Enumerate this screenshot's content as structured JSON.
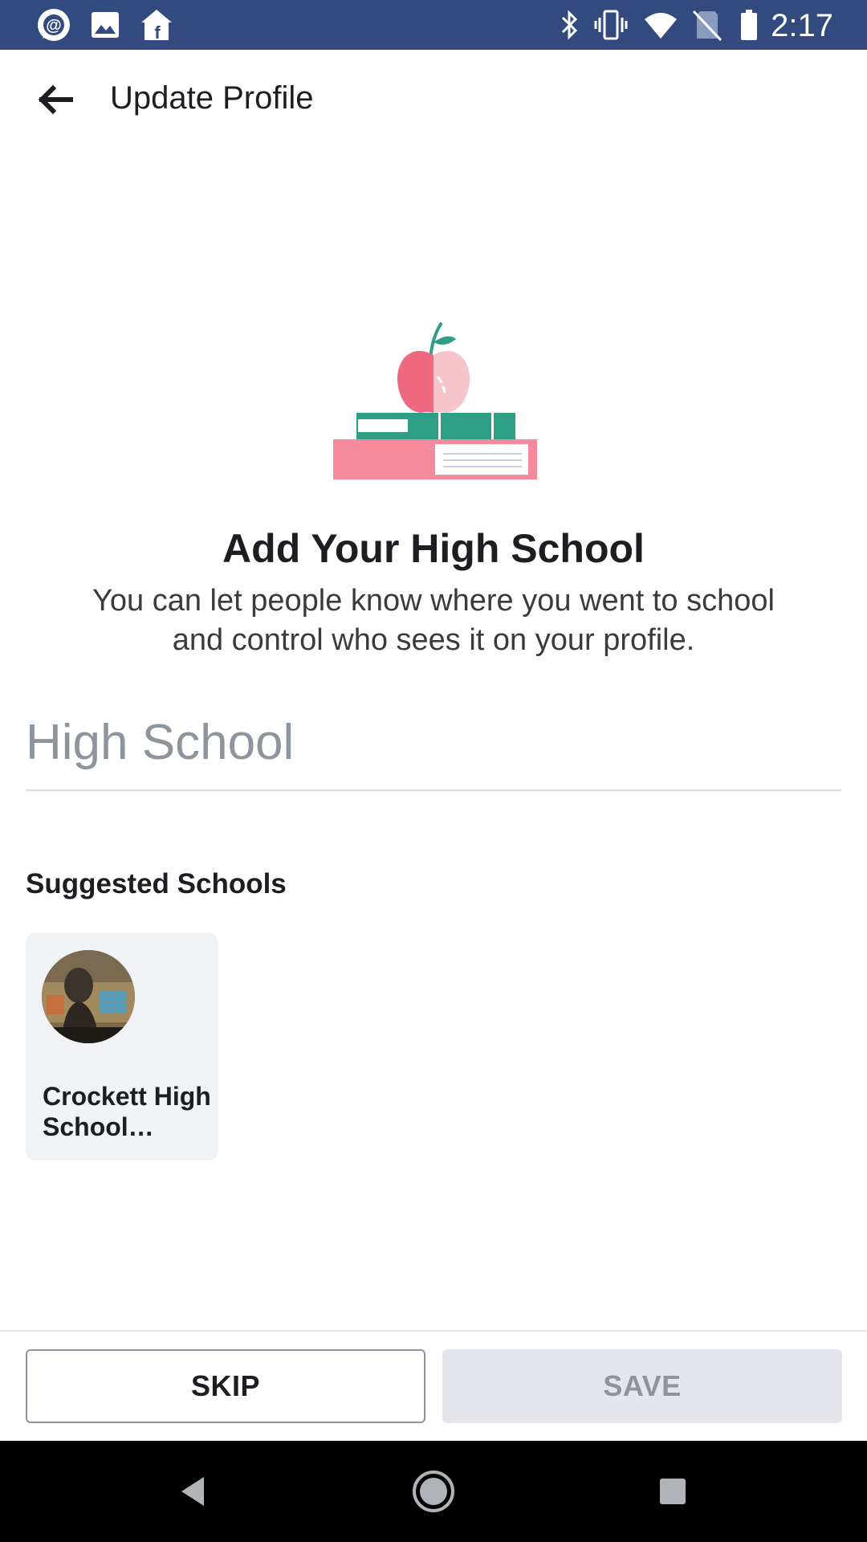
{
  "status_bar": {
    "time": "2:17",
    "left_icons": [
      "workplace-chat-icon",
      "image-icon",
      "facebook-home-icon"
    ],
    "right_icons": [
      "bluetooth-icon",
      "vibrate-icon",
      "wifi-icon",
      "no-sim-icon",
      "battery-icon"
    ],
    "background": "#324a7e"
  },
  "app_bar": {
    "title": "Update Profile",
    "back_icon": "back-arrow-icon"
  },
  "main": {
    "illustration": "apple-on-books-icon",
    "headline": "Add Your High School",
    "subtext": "You can let people know where you went to school and control who sees it on your profile.",
    "input": {
      "placeholder": "High School",
      "value": ""
    },
    "suggested": {
      "title": "Suggested Schools",
      "schools": [
        {
          "name": "Crockett High School…",
          "image": "school-photo"
        }
      ]
    }
  },
  "footer": {
    "skip_label": "SKIP",
    "save_label": "SAVE"
  },
  "nav_bar": {
    "icons": [
      "back-triangle-icon",
      "home-circle-icon",
      "recents-square-icon"
    ]
  }
}
